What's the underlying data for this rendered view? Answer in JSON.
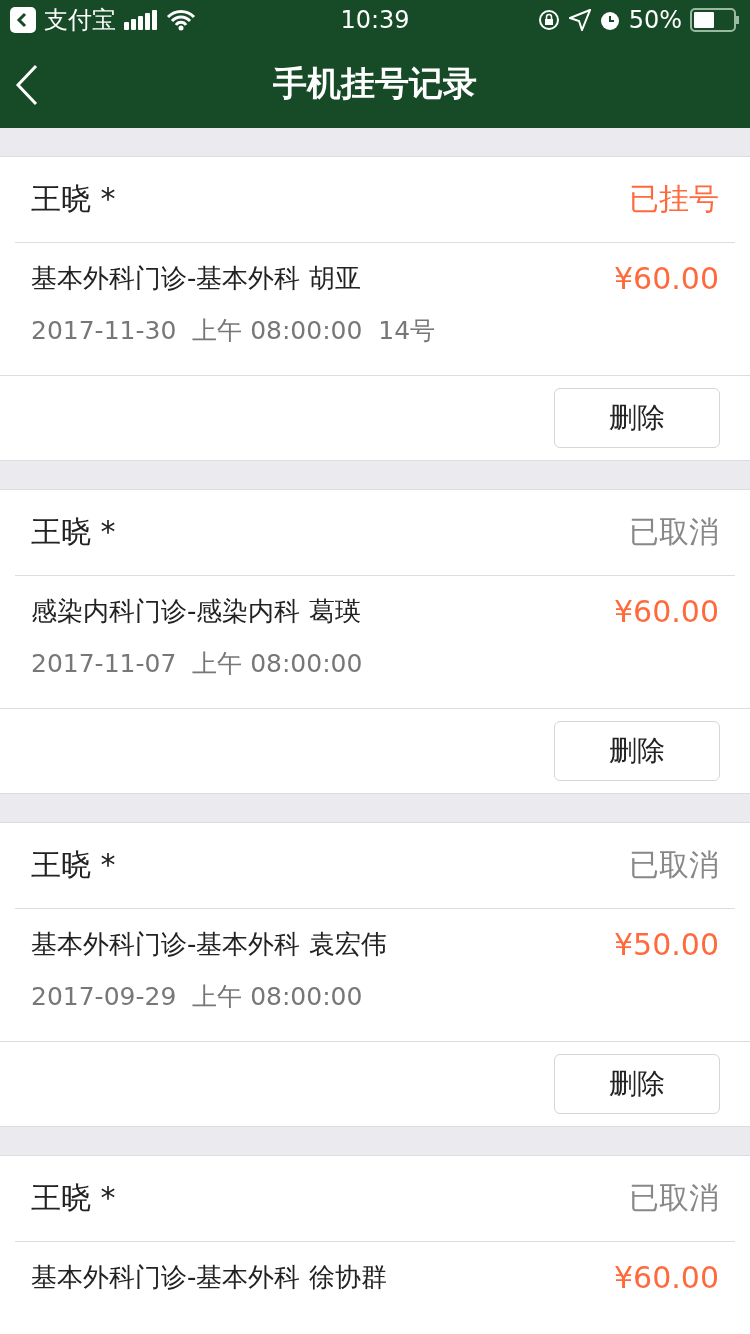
{
  "status_bar": {
    "back_app": "支付宝",
    "time": "10:39",
    "battery": "50%"
  },
  "nav": {
    "title": "手机挂号记录"
  },
  "records": [
    {
      "patient": "王晓 *",
      "status": "已挂号",
      "color": "#ff6a3c",
      "department": "基本外科门诊-基本外科 胡亚",
      "price": "¥60.00",
      "time": "2017-11-30  上午 08:00:00  14号",
      "action": "删除"
    },
    {
      "patient": "王晓 *",
      "status": "已取消",
      "color": "#888888",
      "department": "感染内科门诊-感染内科 葛瑛",
      "price": "¥60.00",
      "time": "2017-11-07  上午 08:00:00",
      "action": "删除"
    },
    {
      "patient": "王晓 *",
      "status": "已取消",
      "color": "#888888",
      "department": "基本外科门诊-基本外科 袁宏伟",
      "price": "¥50.00",
      "time": "2017-09-29  上午 08:00:00",
      "action": "删除"
    },
    {
      "patient": "王晓 *",
      "status": "已取消",
      "color": "#888888",
      "department": "基本外科门诊-基本外科 徐协群",
      "price": "¥60.00"
    }
  ]
}
